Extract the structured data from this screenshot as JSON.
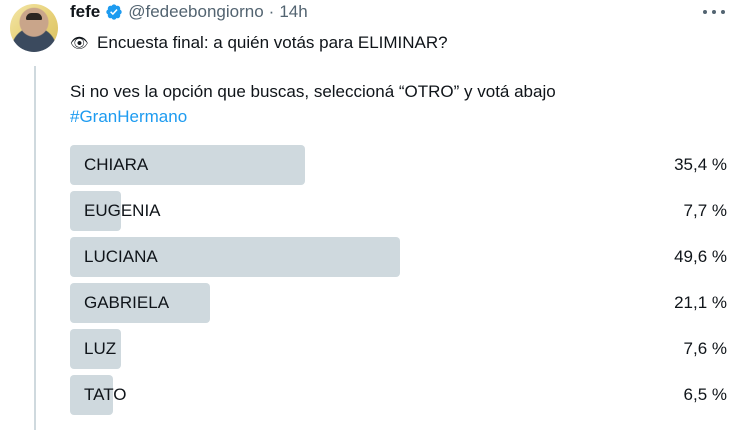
{
  "author": {
    "name": "fefe",
    "handle": "@fedeebongiorno",
    "separator": "·",
    "time": "14h"
  },
  "tweet": {
    "emoji": "👁",
    "line1": "Encuesta final: a quién votás para ELIMINAR?",
    "line2": "Si no ves la opción que buscas, seleccioná “OTRO” y votá abajo",
    "hashtag": "#GranHermano"
  },
  "poll": {
    "options": [
      {
        "label": "CHIARA",
        "percent_text": "35,4 %",
        "percent": 35.4
      },
      {
        "label": "EUGENIA",
        "percent_text": "7,7 %",
        "percent": 7.7
      },
      {
        "label": "LUCIANA",
        "percent_text": "49,6 %",
        "percent": 49.6
      },
      {
        "label": "GABRIELA",
        "percent_text": "21,1 %",
        "percent": 21.1
      },
      {
        "label": "LUZ",
        "percent_text": "7,6 %",
        "percent": 7.6
      },
      {
        "label": "TATO",
        "percent_text": "6,5 %",
        "percent": 6.5
      }
    ]
  },
  "colors": {
    "bar": "#cfd9de",
    "link": "#1d9bf0",
    "verified": "#1d9bf0",
    "muted": "#536471"
  },
  "icons": {
    "verified": "verified-badge-icon",
    "more": "more-options-icon",
    "eye": "eye-emoji-icon"
  }
}
